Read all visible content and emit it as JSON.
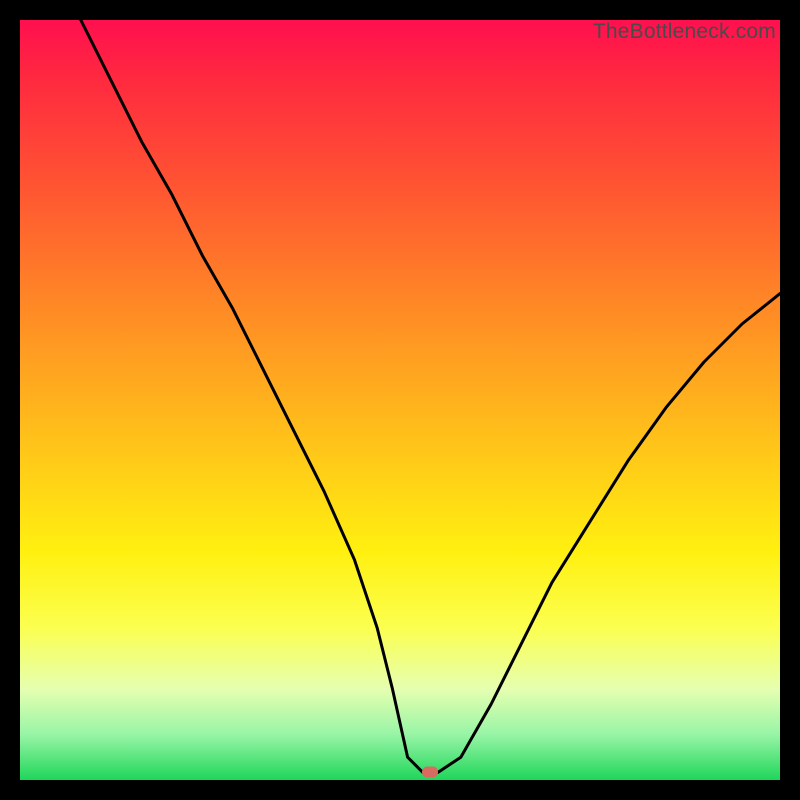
{
  "watermark": "TheBottleneck.com",
  "chart_data": {
    "type": "line",
    "title": "",
    "xlabel": "",
    "ylabel": "",
    "xlim": [
      0,
      100
    ],
    "ylim": [
      0,
      100
    ],
    "grid": false,
    "legend": false,
    "series": [
      {
        "name": "bottleneck-curve",
        "x": [
          8,
          12,
          16,
          20,
          24,
          28,
          32,
          36,
          40,
          44,
          47,
          49,
          51,
          53,
          55,
          58,
          62,
          66,
          70,
          75,
          80,
          85,
          90,
          95,
          100
        ],
        "y": [
          100,
          92,
          84,
          77,
          69,
          62,
          54,
          46,
          38,
          29,
          20,
          12,
          3,
          1,
          1,
          3,
          10,
          18,
          26,
          34,
          42,
          49,
          55,
          60,
          64
        ]
      }
    ],
    "marker": {
      "x": 54,
      "y": 1,
      "color": "#d86b5f"
    },
    "background_gradient": {
      "direction": "vertical",
      "stops": [
        {
          "pos": 0,
          "color": "#ff0f4f"
        },
        {
          "pos": 40,
          "color": "#ff8a25"
        },
        {
          "pos": 70,
          "color": "#fff010"
        },
        {
          "pos": 100,
          "color": "#1fd65a"
        }
      ]
    }
  }
}
